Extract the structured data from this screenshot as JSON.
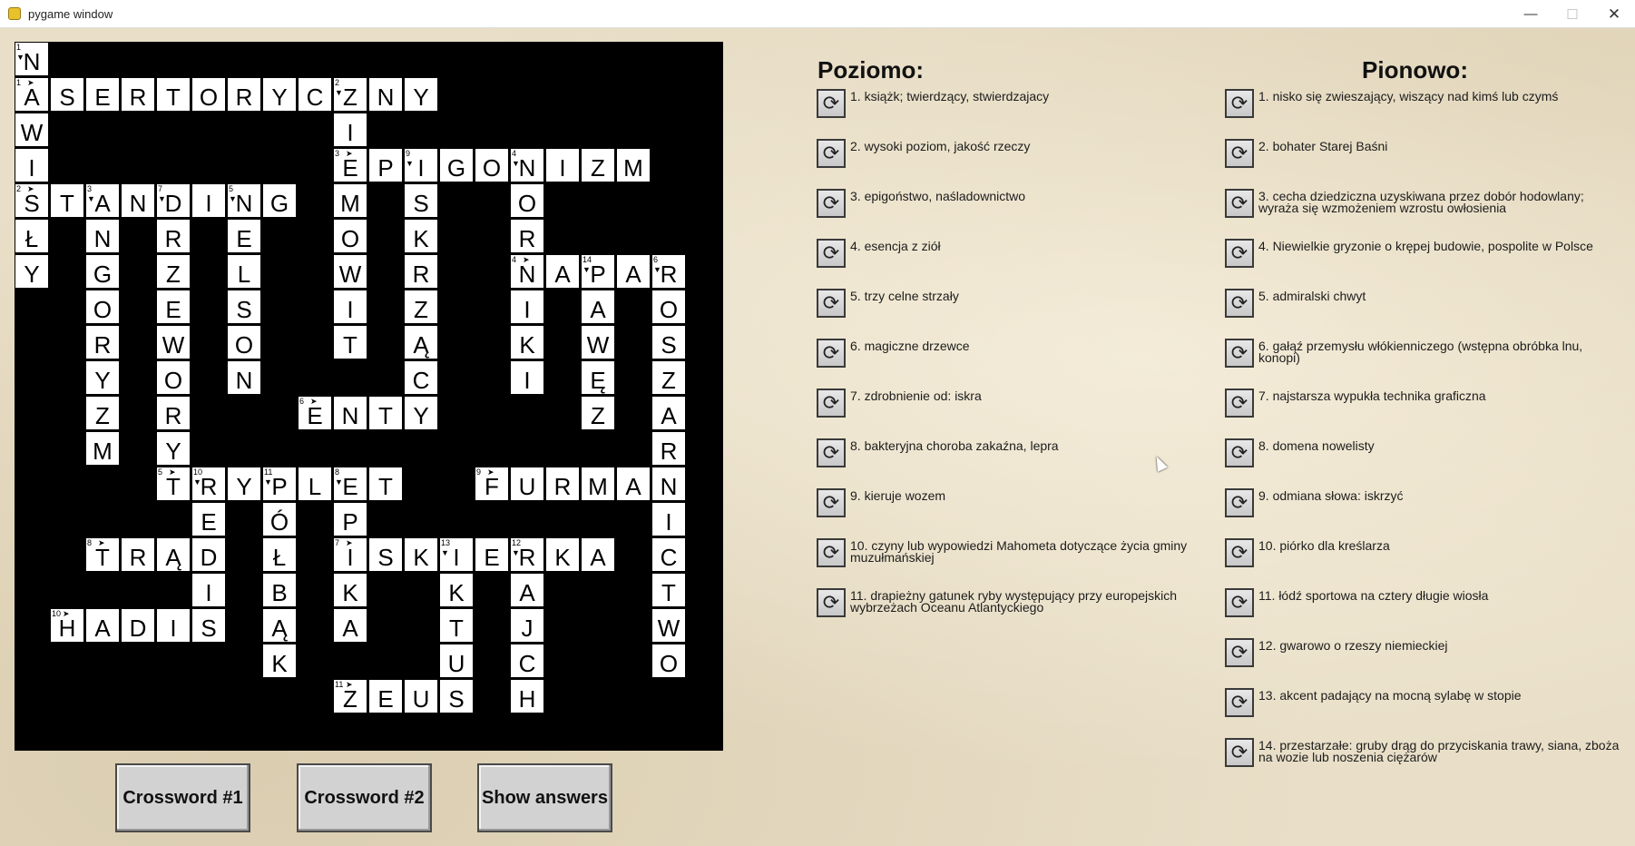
{
  "window": {
    "title": "pygame window",
    "minimize_glyph": "—",
    "maximize_glyph": "☐",
    "close_glyph": "✕"
  },
  "colors": {
    "board": "#000000",
    "cell": "#ffffff",
    "background": "#e9dfc8",
    "button": "#d2d2d2"
  },
  "icons": {
    "app": "pygame-snake-icon",
    "hint": "refresh-icon"
  },
  "board": {
    "columns": 20,
    "rows": 20,
    "cells": [
      {
        "row": 0,
        "col": 0,
        "letter": "N",
        "num": "1",
        "dir": "down"
      },
      {
        "row": 1,
        "col": 0,
        "letter": "A",
        "num": "1",
        "dir": "right"
      },
      {
        "row": 1,
        "col": 1,
        "letter": "S"
      },
      {
        "row": 1,
        "col": 2,
        "letter": "E"
      },
      {
        "row": 1,
        "col": 3,
        "letter": "R"
      },
      {
        "row": 1,
        "col": 4,
        "letter": "T"
      },
      {
        "row": 1,
        "col": 5,
        "letter": "O"
      },
      {
        "row": 1,
        "col": 6,
        "letter": "R"
      },
      {
        "row": 1,
        "col": 7,
        "letter": "Y"
      },
      {
        "row": 1,
        "col": 8,
        "letter": "C"
      },
      {
        "row": 1,
        "col": 9,
        "letter": "Z",
        "num": "2",
        "dir": "down"
      },
      {
        "row": 1,
        "col": 10,
        "letter": "N"
      },
      {
        "row": 1,
        "col": 11,
        "letter": "Y"
      },
      {
        "row": 2,
        "col": 0,
        "letter": "W"
      },
      {
        "row": 2,
        "col": 9,
        "letter": "I"
      },
      {
        "row": 3,
        "col": 0,
        "letter": "I"
      },
      {
        "row": 3,
        "col": 9,
        "letter": "E",
        "num": "3",
        "dir": "right"
      },
      {
        "row": 3,
        "col": 10,
        "letter": "P"
      },
      {
        "row": 3,
        "col": 11,
        "letter": "I",
        "num": "9",
        "dir": "down"
      },
      {
        "row": 3,
        "col": 12,
        "letter": "G"
      },
      {
        "row": 3,
        "col": 13,
        "letter": "O"
      },
      {
        "row": 3,
        "col": 14,
        "letter": "N",
        "num": "4",
        "dir": "down"
      },
      {
        "row": 3,
        "col": 15,
        "letter": "I"
      },
      {
        "row": 3,
        "col": 16,
        "letter": "Z"
      },
      {
        "row": 3,
        "col": 17,
        "letter": "M"
      },
      {
        "row": 4,
        "col": 0,
        "letter": "S",
        "num": "2",
        "dir": "right"
      },
      {
        "row": 4,
        "col": 1,
        "letter": "T"
      },
      {
        "row": 4,
        "col": 2,
        "letter": "A",
        "num": "3",
        "dir": "down"
      },
      {
        "row": 4,
        "col": 3,
        "letter": "N"
      },
      {
        "row": 4,
        "col": 4,
        "letter": "D",
        "num": "7",
        "dir": "down"
      },
      {
        "row": 4,
        "col": 5,
        "letter": "I"
      },
      {
        "row": 4,
        "col": 6,
        "letter": "N",
        "num": "5",
        "dir": "down"
      },
      {
        "row": 4,
        "col": 7,
        "letter": "G"
      },
      {
        "row": 4,
        "col": 9,
        "letter": "M"
      },
      {
        "row": 4,
        "col": 11,
        "letter": "S"
      },
      {
        "row": 4,
        "col": 14,
        "letter": "O"
      },
      {
        "row": 5,
        "col": 0,
        "letter": "Ł"
      },
      {
        "row": 5,
        "col": 2,
        "letter": "N"
      },
      {
        "row": 5,
        "col": 4,
        "letter": "R"
      },
      {
        "row": 5,
        "col": 6,
        "letter": "E"
      },
      {
        "row": 5,
        "col": 9,
        "letter": "O"
      },
      {
        "row": 5,
        "col": 11,
        "letter": "K"
      },
      {
        "row": 5,
        "col": 14,
        "letter": "R"
      },
      {
        "row": 6,
        "col": 0,
        "letter": "Y"
      },
      {
        "row": 6,
        "col": 2,
        "letter": "G"
      },
      {
        "row": 6,
        "col": 4,
        "letter": "Z"
      },
      {
        "row": 6,
        "col": 6,
        "letter": "L"
      },
      {
        "row": 6,
        "col": 9,
        "letter": "W"
      },
      {
        "row": 6,
        "col": 11,
        "letter": "R"
      },
      {
        "row": 6,
        "col": 14,
        "letter": "N",
        "num": "4",
        "dir": "right"
      },
      {
        "row": 6,
        "col": 15,
        "letter": "A"
      },
      {
        "row": 6,
        "col": 16,
        "letter": "P",
        "num": "14",
        "dir": "down"
      },
      {
        "row": 6,
        "col": 17,
        "letter": "A"
      },
      {
        "row": 6,
        "col": 18,
        "letter": "R",
        "num": "6",
        "dir": "down"
      },
      {
        "row": 7,
        "col": 2,
        "letter": "O"
      },
      {
        "row": 7,
        "col": 4,
        "letter": "E"
      },
      {
        "row": 7,
        "col": 6,
        "letter": "S"
      },
      {
        "row": 7,
        "col": 9,
        "letter": "I"
      },
      {
        "row": 7,
        "col": 11,
        "letter": "Z"
      },
      {
        "row": 7,
        "col": 14,
        "letter": "I"
      },
      {
        "row": 7,
        "col": 16,
        "letter": "A"
      },
      {
        "row": 7,
        "col": 18,
        "letter": "O"
      },
      {
        "row": 8,
        "col": 2,
        "letter": "R"
      },
      {
        "row": 8,
        "col": 4,
        "letter": "W"
      },
      {
        "row": 8,
        "col": 6,
        "letter": "O"
      },
      {
        "row": 8,
        "col": 9,
        "letter": "T"
      },
      {
        "row": 8,
        "col": 11,
        "letter": "Ą"
      },
      {
        "row": 8,
        "col": 14,
        "letter": "K"
      },
      {
        "row": 8,
        "col": 16,
        "letter": "W"
      },
      {
        "row": 8,
        "col": 18,
        "letter": "S"
      },
      {
        "row": 9,
        "col": 2,
        "letter": "Y"
      },
      {
        "row": 9,
        "col": 4,
        "letter": "O"
      },
      {
        "row": 9,
        "col": 6,
        "letter": "N"
      },
      {
        "row": 9,
        "col": 11,
        "letter": "C"
      },
      {
        "row": 9,
        "col": 14,
        "letter": "I"
      },
      {
        "row": 9,
        "col": 16,
        "letter": "Ę"
      },
      {
        "row": 9,
        "col": 18,
        "letter": "Z"
      },
      {
        "row": 10,
        "col": 2,
        "letter": "Z"
      },
      {
        "row": 10,
        "col": 4,
        "letter": "R"
      },
      {
        "row": 10,
        "col": 8,
        "letter": "E",
        "num": "6",
        "dir": "right"
      },
      {
        "row": 10,
        "col": 9,
        "letter": "N"
      },
      {
        "row": 10,
        "col": 10,
        "letter": "T"
      },
      {
        "row": 10,
        "col": 11,
        "letter": "Y"
      },
      {
        "row": 10,
        "col": 16,
        "letter": "Z"
      },
      {
        "row": 10,
        "col": 18,
        "letter": "A"
      },
      {
        "row": 11,
        "col": 2,
        "letter": "M"
      },
      {
        "row": 11,
        "col": 4,
        "letter": "Y"
      },
      {
        "row": 11,
        "col": 18,
        "letter": "R"
      },
      {
        "row": 12,
        "col": 4,
        "letter": "T",
        "num": "5",
        "dir": "right"
      },
      {
        "row": 12,
        "col": 5,
        "letter": "R",
        "num": "10",
        "dir": "down"
      },
      {
        "row": 12,
        "col": 6,
        "letter": "Y"
      },
      {
        "row": 12,
        "col": 7,
        "letter": "P",
        "num": "11",
        "dir": "down"
      },
      {
        "row": 12,
        "col": 8,
        "letter": "L"
      },
      {
        "row": 12,
        "col": 9,
        "letter": "E",
        "num": "8",
        "dir": "down"
      },
      {
        "row": 12,
        "col": 10,
        "letter": "T"
      },
      {
        "row": 12,
        "col": 13,
        "letter": "F",
        "num": "9",
        "dir": "right"
      },
      {
        "row": 12,
        "col": 14,
        "letter": "U"
      },
      {
        "row": 12,
        "col": 15,
        "letter": "R"
      },
      {
        "row": 12,
        "col": 16,
        "letter": "M"
      },
      {
        "row": 12,
        "col": 17,
        "letter": "A"
      },
      {
        "row": 12,
        "col": 18,
        "letter": "N"
      },
      {
        "row": 13,
        "col": 5,
        "letter": "E"
      },
      {
        "row": 13,
        "col": 7,
        "letter": "Ó"
      },
      {
        "row": 13,
        "col": 9,
        "letter": "P"
      },
      {
        "row": 13,
        "col": 18,
        "letter": "I"
      },
      {
        "row": 14,
        "col": 2,
        "letter": "T",
        "num": "8",
        "dir": "right"
      },
      {
        "row": 14,
        "col": 3,
        "letter": "R"
      },
      {
        "row": 14,
        "col": 4,
        "letter": "Ą"
      },
      {
        "row": 14,
        "col": 5,
        "letter": "D"
      },
      {
        "row": 14,
        "col": 7,
        "letter": "Ł"
      },
      {
        "row": 14,
        "col": 9,
        "letter": "I",
        "num": "7",
        "dir": "right"
      },
      {
        "row": 14,
        "col": 10,
        "letter": "S"
      },
      {
        "row": 14,
        "col": 11,
        "letter": "K"
      },
      {
        "row": 14,
        "col": 12,
        "letter": "I",
        "num": "13",
        "dir": "down"
      },
      {
        "row": 14,
        "col": 13,
        "letter": "E"
      },
      {
        "row": 14,
        "col": 14,
        "letter": "R",
        "num": "12",
        "dir": "down"
      },
      {
        "row": 14,
        "col": 15,
        "letter": "K"
      },
      {
        "row": 14,
        "col": 16,
        "letter": "A"
      },
      {
        "row": 14,
        "col": 18,
        "letter": "C"
      },
      {
        "row": 15,
        "col": 5,
        "letter": "I"
      },
      {
        "row": 15,
        "col": 7,
        "letter": "B"
      },
      {
        "row": 15,
        "col": 9,
        "letter": "K"
      },
      {
        "row": 15,
        "col": 12,
        "letter": "K"
      },
      {
        "row": 15,
        "col": 14,
        "letter": "A"
      },
      {
        "row": 15,
        "col": 18,
        "letter": "T"
      },
      {
        "row": 16,
        "col": 1,
        "letter": "H",
        "num": "10",
        "dir": "right"
      },
      {
        "row": 16,
        "col": 2,
        "letter": "A"
      },
      {
        "row": 16,
        "col": 3,
        "letter": "D"
      },
      {
        "row": 16,
        "col": 4,
        "letter": "I"
      },
      {
        "row": 16,
        "col": 5,
        "letter": "S"
      },
      {
        "row": 16,
        "col": 7,
        "letter": "Ą"
      },
      {
        "row": 16,
        "col": 9,
        "letter": "A"
      },
      {
        "row": 16,
        "col": 12,
        "letter": "T"
      },
      {
        "row": 16,
        "col": 14,
        "letter": "J"
      },
      {
        "row": 16,
        "col": 18,
        "letter": "W"
      },
      {
        "row": 17,
        "col": 7,
        "letter": "K"
      },
      {
        "row": 17,
        "col": 12,
        "letter": "U"
      },
      {
        "row": 17,
        "col": 14,
        "letter": "C"
      },
      {
        "row": 17,
        "col": 18,
        "letter": "O"
      },
      {
        "row": 18,
        "col": 9,
        "letter": "Z",
        "num": "11",
        "dir": "right"
      },
      {
        "row": 18,
        "col": 10,
        "letter": "E"
      },
      {
        "row": 18,
        "col": 11,
        "letter": "U"
      },
      {
        "row": 18,
        "col": 12,
        "letter": "S"
      },
      {
        "row": 18,
        "col": 14,
        "letter": "H"
      }
    ]
  },
  "across": {
    "heading": "Poziomo:",
    "clues": [
      "1. książk; twierdzący, stwierdzajacy",
      "2. wysoki poziom, jakość rzeczy",
      "3. epigoństwo, naśladownictwo",
      "4. esencja z ziół",
      "5. trzy celne strzały",
      "6. magiczne drzewce",
      "7. zdrobnienie od: iskra",
      "8. bakteryjna choroba zakaźna, lepra",
      "9. kieruje wozem",
      "10. czyny lub wypowiedzi Mahometa dotyczące życia gminy muzułmańskiej",
      "11. drapieżny gatunek ryby występujący przy europejskich wybrzeżach Oceanu Atlantyckiego"
    ]
  },
  "down": {
    "heading": "Pionowo:",
    "clues": [
      "1. nisko się zwieszający, wiszący nad kimś lub czymś",
      "2. bohater Starej Baśni",
      "3. cecha dziedziczna uzyskiwana przez dobór hodowlany; wyraża się wzmożeniem wzrostu owłosienia",
      "4. Niewielkie gryzonie o krępej budowie, pospolite w Polsce",
      "5. admiralski chwyt",
      "6. gałąź przemysłu włókienniczego (wstępna obróbka lnu, konopi)",
      "7. najstarsza wypukła technika graficzna",
      "8. domena nowelisty",
      "9. odmiana słowa: iskrzyć",
      "10. piórko dla kreślarza",
      "11. łódź sportowa na cztery długie wiosła",
      "12. gwarowo o rzeszy niemieckiej",
      "13. akcent padający na mocną sylabę w stopie",
      "14. przestarzałe: gruby drąg do przyciskania trawy, siana, zboża na wozie lub noszenia ciężarów"
    ]
  },
  "buttons": {
    "crossword1": "Crossword #1",
    "crossword2": "Crossword #2",
    "show_answers": "Show answers"
  }
}
